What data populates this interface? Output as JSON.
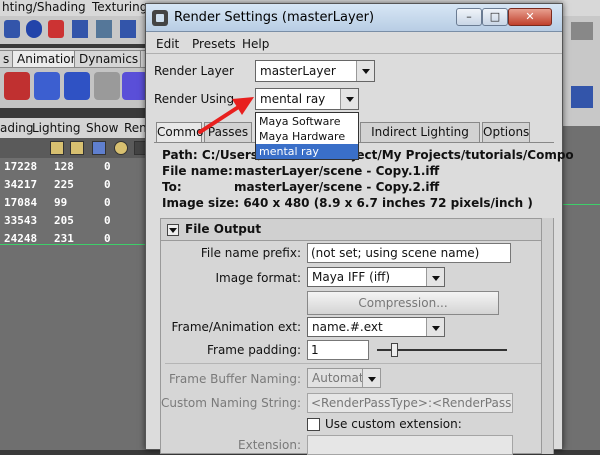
{
  "background": {
    "menubar": [
      "hting/Shading",
      "Texturing"
    ],
    "tabs": [
      "s",
      "Animation",
      "Dynamics",
      "R"
    ],
    "panel_menu": [
      "ading",
      "Lighting",
      "Show",
      "Ren"
    ],
    "hud_rows": [
      {
        "a": "17228",
        "b": "128",
        "c": "0"
      },
      {
        "a": "34217",
        "b": "225",
        "c": "0"
      },
      {
        "a": "17084",
        "b": "99",
        "c": "0"
      },
      {
        "a": "33543",
        "b": "205",
        "c": "0"
      },
      {
        "a": "24248",
        "b": "231",
        "c": "0"
      }
    ]
  },
  "dialog": {
    "title": "Render Settings (masterLayer)",
    "window_buttons": {
      "minimize": "–",
      "maximize": "□",
      "close": "✕"
    },
    "menu": [
      "Edit",
      "Presets",
      "Help"
    ],
    "render_layer": {
      "label": "Render Layer",
      "value": "masterLayer"
    },
    "render_using": {
      "label": "Render Using",
      "value": "mental ray",
      "options": [
        "Maya Software",
        "Maya Hardware",
        "mental ray"
      ],
      "selected_index": 2
    },
    "tabs": [
      "Common",
      "Passes",
      "",
      "Indirect Lighting",
      "Options"
    ],
    "active_tab": "Common",
    "info": {
      "path": "Path: C:/Users/",
      "path_tail": "oject/My Projects/tutorials/Compo",
      "file_name_label": "File name:",
      "file_name": "masterLayer/scene - Copy.1.iff",
      "to_label": "To:",
      "to": "masterLayer/scene - Copy.2.iff",
      "image_size": "Image size: 640 x 480 (8.9 x 6.7 inches 72 pixels/inch )"
    },
    "file_output": {
      "title": "File Output",
      "file_name_prefix": {
        "label": "File name prefix:",
        "value": "(not set; using scene name)"
      },
      "image_format": {
        "label": "Image format:",
        "value": "Maya IFF (iff)"
      },
      "compression_button": "Compression...",
      "frame_ext": {
        "label": "Frame/Animation ext:",
        "value": "name.#.ext"
      },
      "frame_padding": {
        "label": "Frame padding:",
        "value": "1"
      },
      "frame_buffer_naming": {
        "label": "Frame Buffer Naming:",
        "value": "Automatic"
      },
      "custom_naming": {
        "label": "Custom Naming String:",
        "value": "<RenderPassType>:<RenderPass>.<Came"
      },
      "use_custom_ext": {
        "label": "Use custom extension:",
        "checked": false
      },
      "extension": {
        "label": "Extension:",
        "value": ""
      }
    }
  },
  "colors": {
    "selection": "#3a6fc8",
    "annotation_arrow": "#e8201e"
  }
}
